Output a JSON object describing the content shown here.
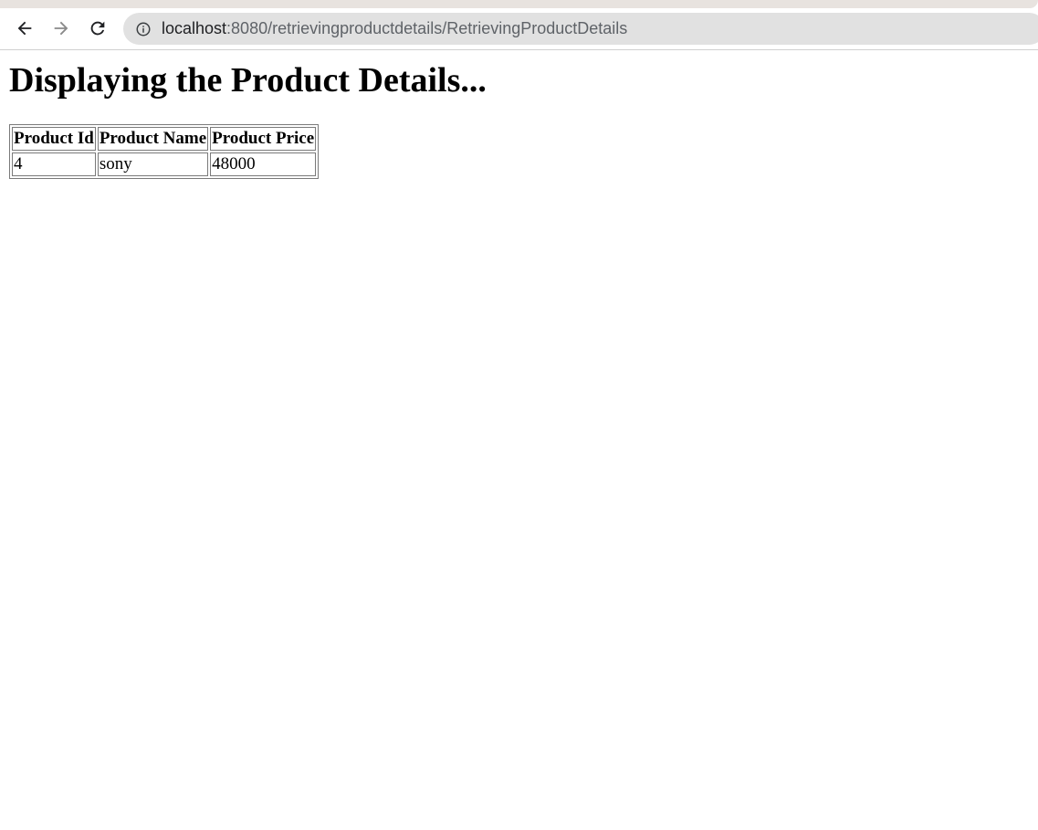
{
  "browser": {
    "url_host": "localhost",
    "url_rest": ":8080/retrievingproductdetails/RetrievingProductDetails"
  },
  "page": {
    "heading": "Displaying the Product Details...",
    "table": {
      "headers": [
        "Product Id",
        "Product Name",
        "Product Price"
      ],
      "rows": [
        [
          "4",
          "sony",
          "48000"
        ]
      ]
    }
  }
}
